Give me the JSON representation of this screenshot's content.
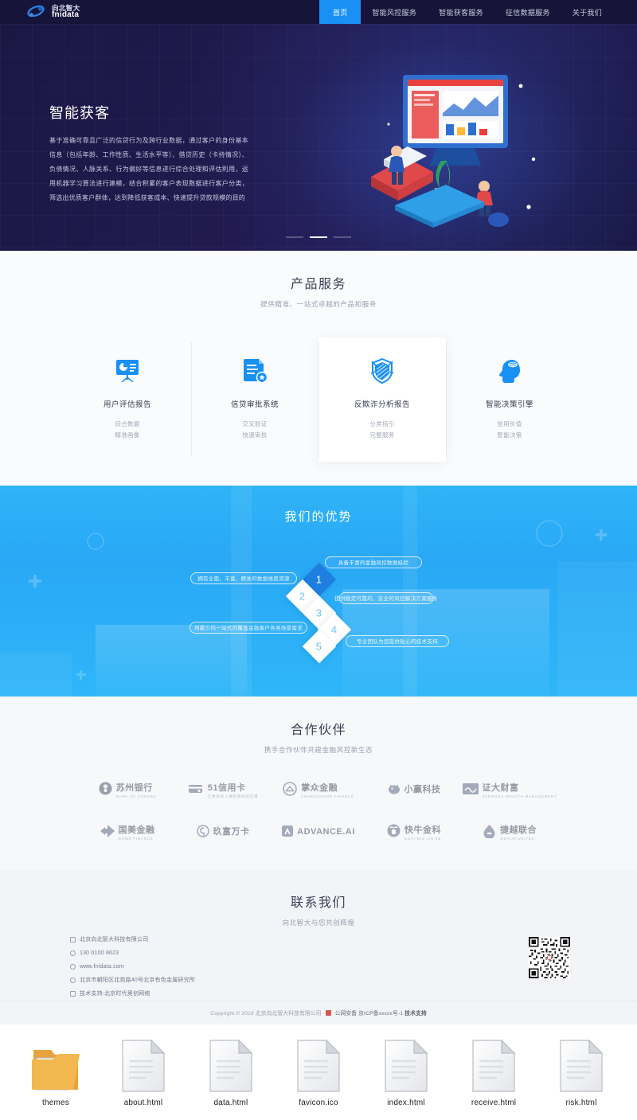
{
  "site": {
    "logo_cn": "向北智大",
    "logo_en": "fnidata"
  },
  "nav": {
    "items": [
      {
        "label": "首页",
        "active": true
      },
      {
        "label": "智能风控服务",
        "active": false
      },
      {
        "label": "智能获客服务",
        "active": false
      },
      {
        "label": "征信数据服务",
        "active": false
      },
      {
        "label": "关于我们",
        "active": false
      }
    ]
  },
  "hero": {
    "title": "智能获客",
    "desc": "基于准确可靠且广泛的信贷行为及跨行业数据，通过客户的身份基本信息（包括年龄、工作性质、生活水平等）、借贷历史（卡持情况）、负债情况、人脉关系、行为偏好等信息进行综合处理和评估利用，运用机器学习算法进行建模，结合积累的客户表现数据进行客户分类，筛选出优质客户群体，达到降低获客成本、快速提升贷款规模的目的",
    "slides": [
      {
        "active": false
      },
      {
        "active": true
      },
      {
        "active": false
      }
    ]
  },
  "products": {
    "title": "产品服务",
    "subtitle": "提供精准、一站式卓越的产品和服务",
    "cards": [
      {
        "icon": "presentation-chart-icon",
        "name": "用户评估报告",
        "meta_1": "综合数据",
        "meta_2": "精准画像",
        "highlight": false
      },
      {
        "icon": "document-approval-icon",
        "name": "信贷审批系统",
        "meta_1": "交叉验证",
        "meta_2": "快速审批",
        "highlight": false
      },
      {
        "icon": "shield-icon",
        "name": "反欺诈分析报告",
        "meta_1": "分类指引",
        "meta_2": "完整服务",
        "highlight": true
      },
      {
        "icon": "brain-head-icon",
        "name": "智能决策引擎",
        "meta_1": "信用价值",
        "meta_2": "智能决策",
        "highlight": false
      }
    ]
  },
  "advantage": {
    "title": "我们的优势",
    "steps": [
      {
        "num": "1",
        "highlight": true
      },
      {
        "num": "2",
        "highlight": false
      },
      {
        "num": "3",
        "highlight": false
      },
      {
        "num": "4",
        "highlight": false
      },
      {
        "num": "5",
        "highlight": false
      }
    ],
    "pills": [
      {
        "text": "具备丰富的金融风控数据经验"
      },
      {
        "text": "拥有全面、丰富、精准的数据维度资源"
      },
      {
        "text": "提供稳定可靠的、安全的风控解决方案服务"
      },
      {
        "text": "用最少内一站式的覆盖金融客户各类场景需求"
      },
      {
        "text": "专业团队为您提供贴心的技术支持"
      }
    ]
  },
  "partners": {
    "title": "合作伙伴",
    "subtitle": "携手合作伙伴共建金融风控新生态",
    "logos": [
      {
        "cn": "苏州银行",
        "en": "BANK OF SUZHOU",
        "mark": "bank-seal-icon"
      },
      {
        "cn": "51信用卡",
        "en": "让更多的人拥有更好的信用",
        "mark": "card-stack-icon"
      },
      {
        "cn": "掌众金融",
        "en": "ZHANGZHONG FINANCE",
        "mark": "palm-circle-icon"
      },
      {
        "cn": "小赢科技",
        "en": "",
        "mark": "piggy-icon"
      },
      {
        "cn": "证大财富",
        "en": "ZHENGDA WEALTH MANAGEMENT",
        "mark": "square-wave-icon"
      },
      {
        "cn": "国美金融",
        "en": "GOME FINANCE",
        "mark": "arrow-flag-icon"
      },
      {
        "cn": "玖富万卡",
        "en": "",
        "mark": "circle-nine-icon"
      },
      {
        "cn": "ADVANCE.AI",
        "en": "",
        "mark": "triangle-a-icon"
      },
      {
        "cn": "快牛金科",
        "en": "KUAI NIU JIN KE",
        "mark": "ox-circle-icon"
      },
      {
        "cn": "捷越联合",
        "en": "JIEYUE UNITED",
        "mark": "droplet-icon"
      }
    ]
  },
  "contact": {
    "title": "联系我们",
    "subtitle": "向北智大与您共创辉煌",
    "rows": [
      {
        "icon": "building-icon",
        "text": "北京向北智大科技有限公司"
      },
      {
        "icon": "phone-icon",
        "text": "130 0100 8623"
      },
      {
        "icon": "globe-icon",
        "text": "www.fnidata.com"
      },
      {
        "icon": "location-icon",
        "text": "北京市朝阳区北苑路40号北京有色金属研究所"
      },
      {
        "icon": "wrench-icon",
        "text": "技术支持:北京时代奥创网络"
      }
    ],
    "qr_alt": "qr-code"
  },
  "footer": {
    "copyright": "Copyright © 2019 北京向北智大科技有限公司",
    "police": "公网安备 京ICP备xxxxx号-1",
    "support": "技术支持"
  },
  "desktop": {
    "files": [
      {
        "name": "themes",
        "type": "folder"
      },
      {
        "name": "about.html",
        "type": "file"
      },
      {
        "name": "data.html",
        "type": "file"
      },
      {
        "name": "favicon.ico",
        "type": "file"
      },
      {
        "name": "index.html",
        "type": "file"
      },
      {
        "name": "receive.html",
        "type": "file"
      },
      {
        "name": "risk.html",
        "type": "file"
      }
    ]
  },
  "colors": {
    "accent": "#1890f4",
    "hero_bg": "#1b1744",
    "advantage_bg": "#2fb4f7"
  }
}
